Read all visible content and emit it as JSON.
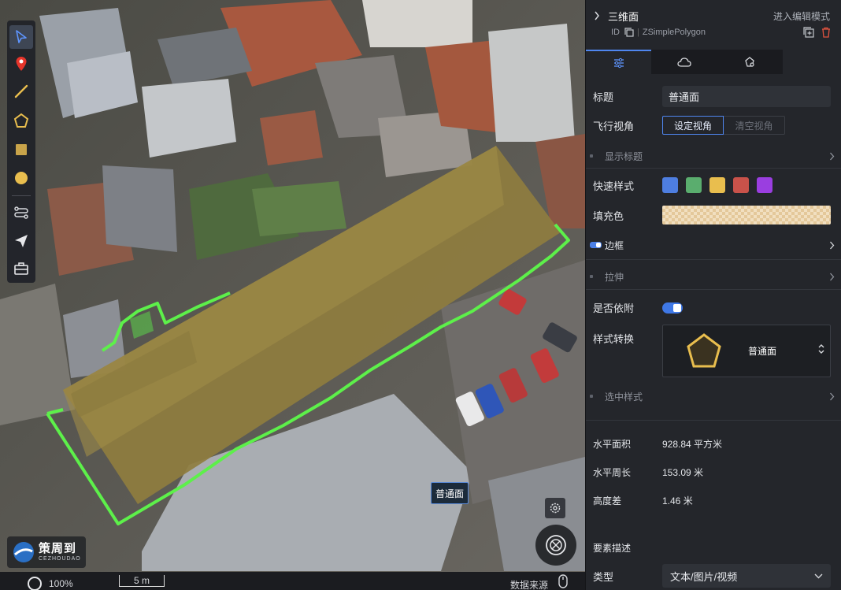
{
  "map": {
    "feature_label": "普通面",
    "logo_cn": "策周到",
    "logo_en": "CEZHOUDAO",
    "statusbar": {
      "zoom": "100%",
      "scale": "5 m",
      "data_source": "数据来源"
    },
    "tools": [
      "select-arrow-icon",
      "map-marker-icon",
      "line-draw-icon",
      "polygon-draw-icon",
      "rectangle-draw-icon",
      "circle-draw-icon",
      "route-icon",
      "send-icon",
      "toolbox-icon"
    ]
  },
  "panel": {
    "title": "三维面",
    "edit_mode": "进入编辑模式",
    "id_label": "ID",
    "id_value": "ZSimplePolygon",
    "tabs": [
      "style-tab-icon",
      "cloud-tab-icon",
      "shape-tab-icon"
    ],
    "fields": {
      "title_label": "标题",
      "title_value": "普通面",
      "view_label": "飞行视角",
      "view_set": "设定视角",
      "view_clear": "清空视角",
      "show_title": "显示标题",
      "quick_style_label": "快速样式",
      "quick_styles": [
        "#4e7ee0",
        "#5aad6e",
        "#e9be4e",
        "#c9524a",
        "#9a3ee0"
      ],
      "fill_label": "填充色",
      "border_label": "边框",
      "extrude_label": "拉伸",
      "attach_label": "是否依附",
      "style_convert_label": "样式转换",
      "style_convert_value": "普通面",
      "selected_style": "选中样式"
    },
    "measure": {
      "area_label": "水平面积",
      "area_value": "928.84 平方米",
      "perimeter_label": "水平周长",
      "perimeter_value": "153.09 米",
      "height_label": "高度差",
      "height_value": "1.46 米"
    },
    "desc_label": "要素描述",
    "type_label": "类型",
    "type_value": "文本/图片/视频"
  }
}
